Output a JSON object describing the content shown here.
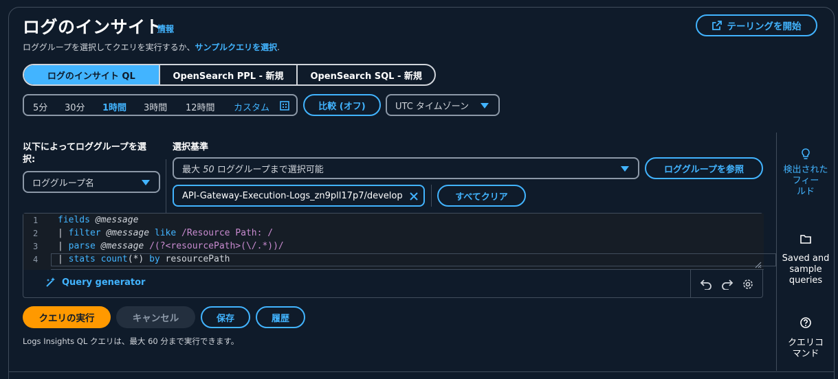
{
  "header": {
    "title": "ログのインサイト",
    "info_link": "情報",
    "subtitle_prefix": "ロググループを選択してクエリを実行するか、",
    "subtitle_link": "サンプルクエリを選択",
    "subtitle_suffix": ".",
    "tail_button": "テーリングを開始"
  },
  "query_language_tabs": [
    {
      "label": "ログのインサイト QL",
      "active": true
    },
    {
      "label": "OpenSearch PPL - 新規",
      "active": false
    },
    {
      "label": "OpenSearch SQL - 新規",
      "active": false
    }
  ],
  "time_range": {
    "options": [
      "5分",
      "30分",
      "1時間",
      "3時間",
      "12時間"
    ],
    "selected": "1時間",
    "custom_label": "カスタム"
  },
  "compare_button": "比較 (オフ)",
  "timezone_select": "UTC タイムゾーン",
  "log_group_selection": {
    "label": "以下によってロググループを選択:",
    "label_line1": "以下によってロググループを選",
    "label_line2": "択:",
    "mode_select": "ロググループ名",
    "criteria_label": "選択基準",
    "criteria_placeholder_prefix": "最大 ",
    "criteria_placeholder_num": "50",
    "criteria_placeholder_suffix": " ロググループまで選択可能",
    "browse_button": "ロググループを参照",
    "selected_token": "API-Gateway-Execution-Logs_zn9pll17p7/develop",
    "clear_all_button": "すべてクリア"
  },
  "editor": {
    "line_numbers": [
      "1",
      "2",
      "3",
      "4"
    ],
    "query_generator": "Query generator"
  },
  "actions": {
    "run": "クエリの実行",
    "cancel": "キャンセル",
    "save": "保存",
    "history": "履歴"
  },
  "note": "Logs Insights QL クエリは、最大 60 分まで実行できます。",
  "side_panel": {
    "discovered_fields": "検出された\nフィー\nルド",
    "saved_queries": "Saved and\nsample\nqueries",
    "query_commands": "クエリコ\nマンド"
  },
  "colors": {
    "accent": "#42b4ff",
    "primary": "#ff9900",
    "background": "#0f1b2a"
  }
}
